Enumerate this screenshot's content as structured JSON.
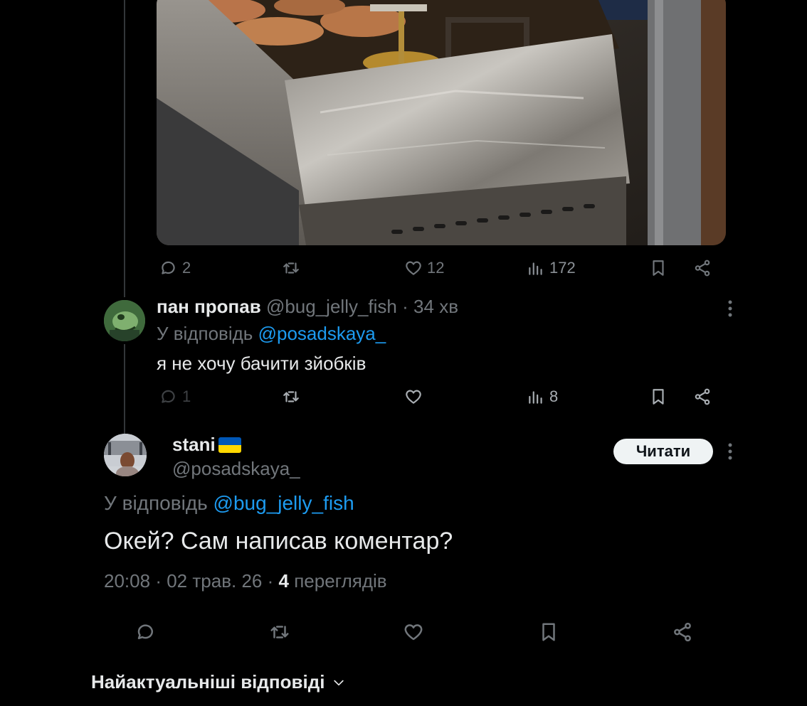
{
  "first_tweet": {
    "media": {
      "alt": "photo"
    },
    "actions": {
      "replies": "2",
      "reposts": "",
      "likes": "12",
      "views": "172"
    }
  },
  "reply": {
    "display_name": "пан пропав",
    "handle": "@bug_jelly_fish",
    "separator": "·",
    "time": "34 хв",
    "reply_prefix": "У відповідь",
    "reply_to": "@posadskaya_",
    "text": "я не хочу бачити зйобків",
    "actions": {
      "replies": "1",
      "reposts": "",
      "likes": "",
      "views": "8"
    }
  },
  "main_tweet": {
    "display_name": "stani",
    "handle": "@posadskaya_",
    "follow_label": "Читати",
    "reply_prefix": "У відповідь",
    "reply_to": "@bug_jelly_fish",
    "text": "Окей? Сам написав коментар?",
    "time": "20:08",
    "dot1": "·",
    "date": "02 трав. 26",
    "dot2": "·",
    "views_count": "4",
    "views_label": "переглядів"
  },
  "sort_label": "Найактуальніші відповіді",
  "colors": {
    "background": "#000000",
    "text": "#e7e9ea",
    "muted": "#71767b",
    "link": "#1d9bf0",
    "flag_blue": "#0057b7",
    "flag_yellow": "#ffd700"
  }
}
